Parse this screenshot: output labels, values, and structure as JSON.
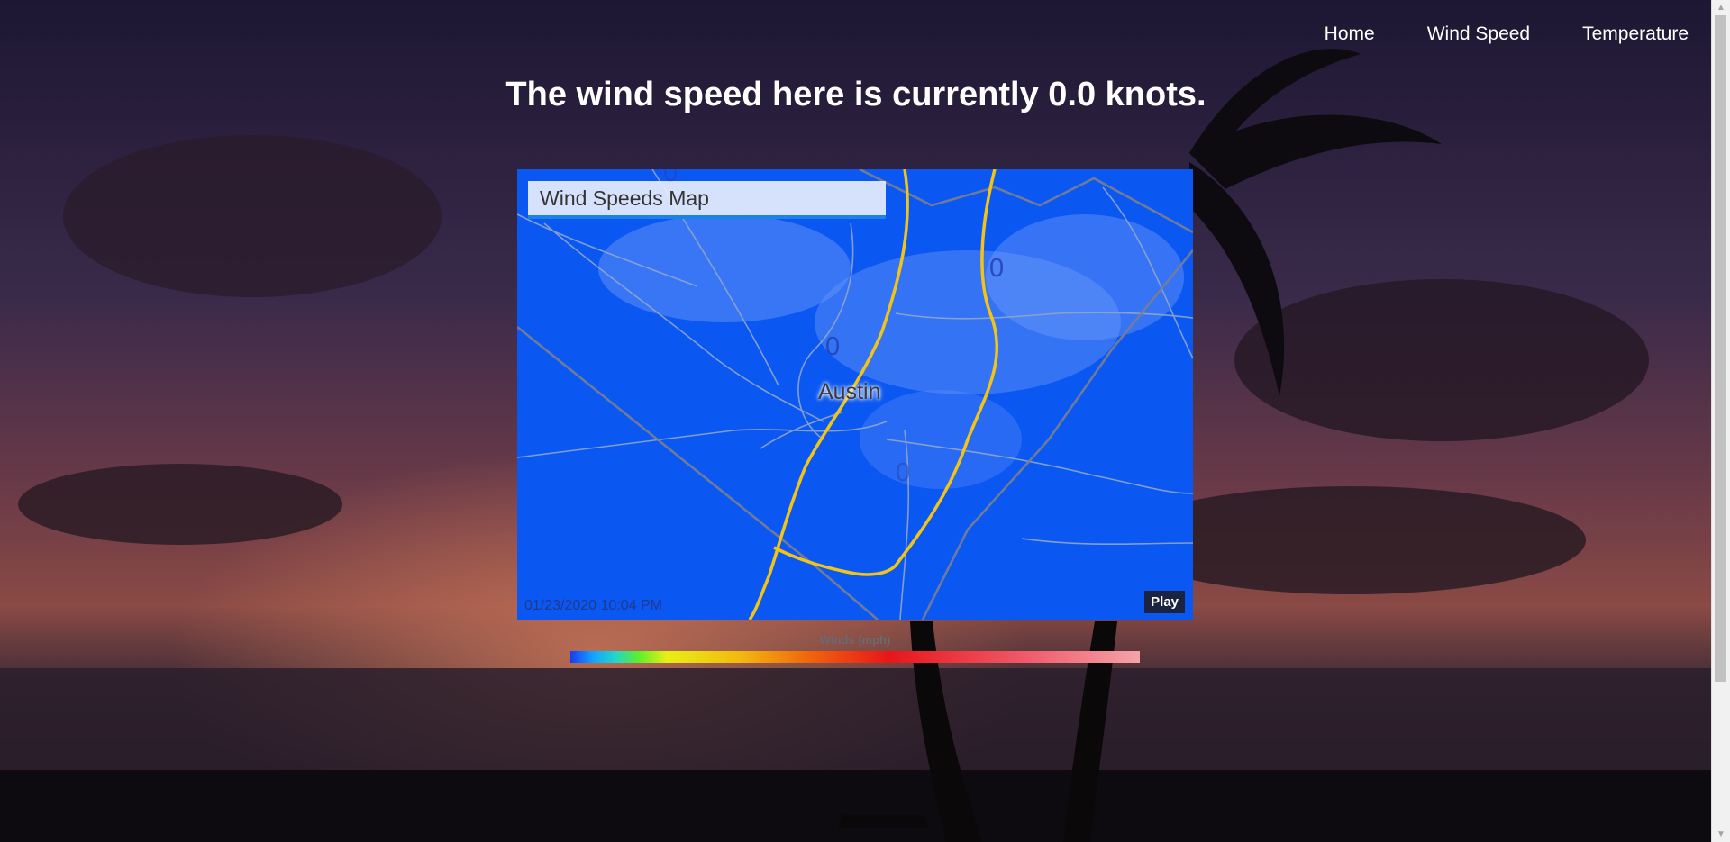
{
  "nav": {
    "items": [
      {
        "label": "Home"
      },
      {
        "label": "Wind Speed"
      },
      {
        "label": "Temperature"
      }
    ]
  },
  "headline": "The wind speed here is currently 0.0 knots.",
  "map": {
    "title": "Wind Speeds Map",
    "city": "Austin",
    "wind_labels": [
      "0",
      "0",
      "0",
      "0"
    ],
    "timestamp": "01/23/2020 10:04 PM",
    "play_label": "Play",
    "base_color": "#0b57f2",
    "road_color": "#f2c418"
  },
  "legend": {
    "title": "Winds (mph)"
  },
  "colors": {
    "nav_text": "#ffffff",
    "headline_text": "#ffffff"
  }
}
